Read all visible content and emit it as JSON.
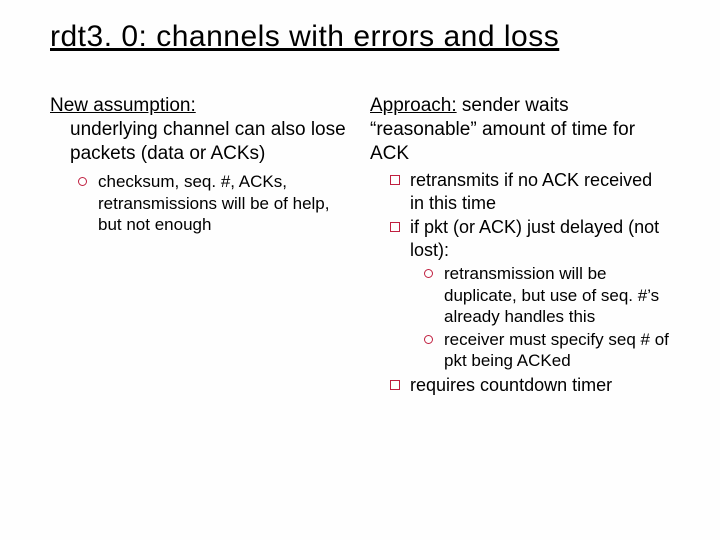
{
  "title": "rdt3. 0: channels with errors and loss",
  "left": {
    "lead": "New assumption:",
    "body": "underlying channel can also lose packets (data or ACKs)",
    "sub1": "checksum, seq. #, ACKs, retransmissions will be of help, but not enough"
  },
  "right": {
    "lead": "Approach:",
    "body": " sender waits “reasonable” amount of time for ACK",
    "b1": "retransmits if no ACK received in this time",
    "b2": "if pkt (or ACK) just delayed (not lost):",
    "b2a": "retransmission will be duplicate, but use of seq. #’s already handles this",
    "b2b": "receiver must specify seq # of pkt being ACKed",
    "b3": "requires countdown timer"
  }
}
